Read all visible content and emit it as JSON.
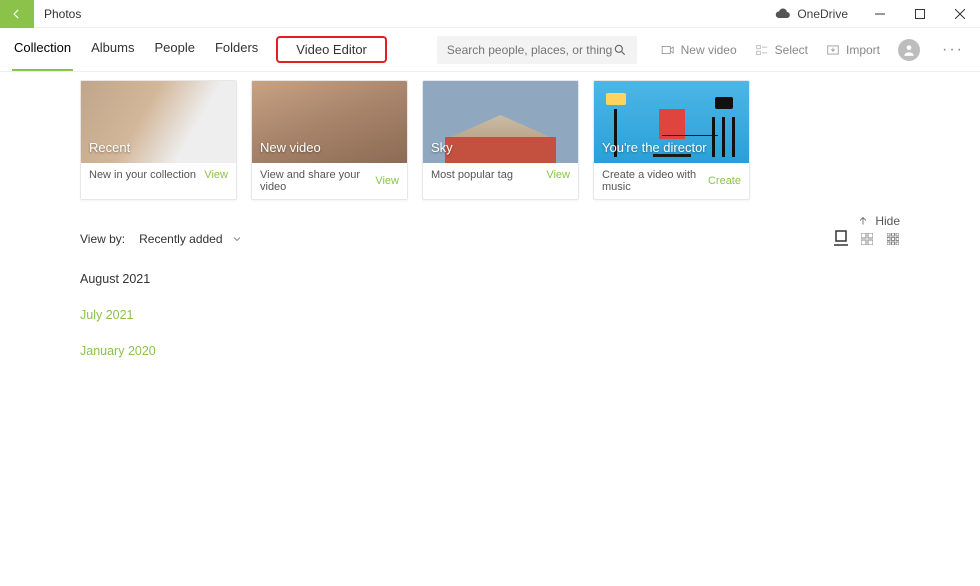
{
  "titlebar": {
    "app_name": "Photos",
    "onedrive_label": "OneDrive"
  },
  "tabs": {
    "collection": "Collection",
    "albums": "Albums",
    "people": "People",
    "folders": "Folders",
    "video_editor": "Video Editor"
  },
  "search": {
    "placeholder": "Search people, places, or things..."
  },
  "nav_actions": {
    "new_video": "New video",
    "select": "Select",
    "import": "Import"
  },
  "cards": [
    {
      "title": "Recent",
      "subtitle": "New in your collection",
      "action": "View"
    },
    {
      "title": "New video",
      "subtitle": "View and share your video",
      "action": "View"
    },
    {
      "title": "Sky",
      "subtitle": "Most popular tag",
      "action": "View"
    },
    {
      "title": "You're the director",
      "subtitle": "Create a video with music",
      "action": "Create"
    }
  ],
  "hide_label": "Hide",
  "viewby": {
    "label": "View by:",
    "selected": "Recently added"
  },
  "dates": [
    {
      "label": "August 2021",
      "link": false
    },
    {
      "label": "July 2021",
      "link": true
    },
    {
      "label": "January 2020",
      "link": true
    }
  ]
}
